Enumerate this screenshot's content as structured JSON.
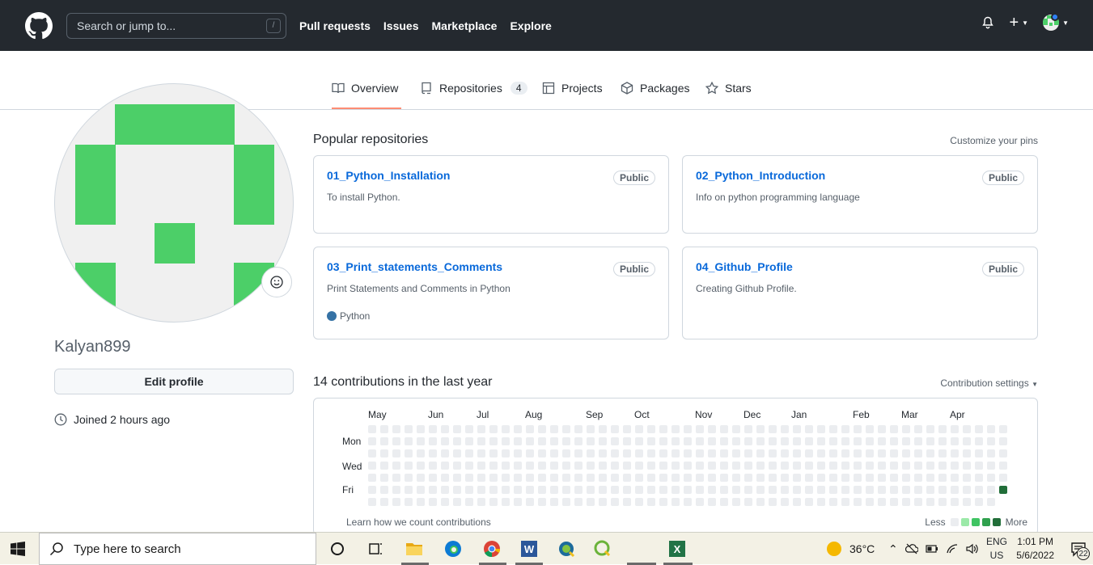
{
  "header": {
    "search_placeholder": "Search or jump to...",
    "search_shortcut": "/",
    "nav": [
      "Pull requests",
      "Issues",
      "Marketplace",
      "Explore"
    ],
    "plus_label": "+"
  },
  "tabs": [
    {
      "label": "Overview",
      "icon": "book-icon",
      "active": true
    },
    {
      "label": "Repositories",
      "icon": "repo-icon",
      "count": "4"
    },
    {
      "label": "Projects",
      "icon": "table-icon"
    },
    {
      "label": "Packages",
      "icon": "package-icon"
    },
    {
      "label": "Stars",
      "icon": "star-icon"
    }
  ],
  "profile": {
    "username": "Kalyan899",
    "edit_label": "Edit profile",
    "joined": "Joined 2 hours ago"
  },
  "popular": {
    "title": "Popular repositories",
    "customize": "Customize your pins",
    "repos": [
      {
        "name": "01_Python_Installation",
        "badge": "Public",
        "desc": "To install Python.",
        "lang": ""
      },
      {
        "name": "02_Python_Introduction",
        "badge": "Public",
        "desc": "Info on python programming language",
        "lang": ""
      },
      {
        "name": "03_Print_statements_Comments",
        "badge": "Public",
        "desc": "Print Statements and Comments in Python",
        "lang": "Python",
        "lang_color": "#3572A5"
      },
      {
        "name": "04_Github_Profile",
        "badge": "Public",
        "desc": "Creating Github Profile.",
        "lang": ""
      }
    ]
  },
  "contrib": {
    "title": "14 contributions in the last year",
    "settings": "Contribution settings",
    "months": [
      "May",
      "Jun",
      "Jul",
      "Aug",
      "Sep",
      "Oct",
      "Nov",
      "Dec",
      "Jan",
      "Feb",
      "Mar",
      "Apr"
    ],
    "days": [
      "Mon",
      "Wed",
      "Fri"
    ],
    "learn": "Learn how we count contributions",
    "less": "Less",
    "more": "More",
    "colors": [
      "#ebedf0",
      "#9be9a8",
      "#40c463",
      "#30a14e",
      "#216e39"
    ]
  },
  "taskbar": {
    "search_placeholder": "Type here to search",
    "weather": "36°C",
    "lang_top": "ENG",
    "lang_bottom": "US",
    "time": "1:01 PM",
    "date": "5/6/2022",
    "notif_count": "22"
  }
}
